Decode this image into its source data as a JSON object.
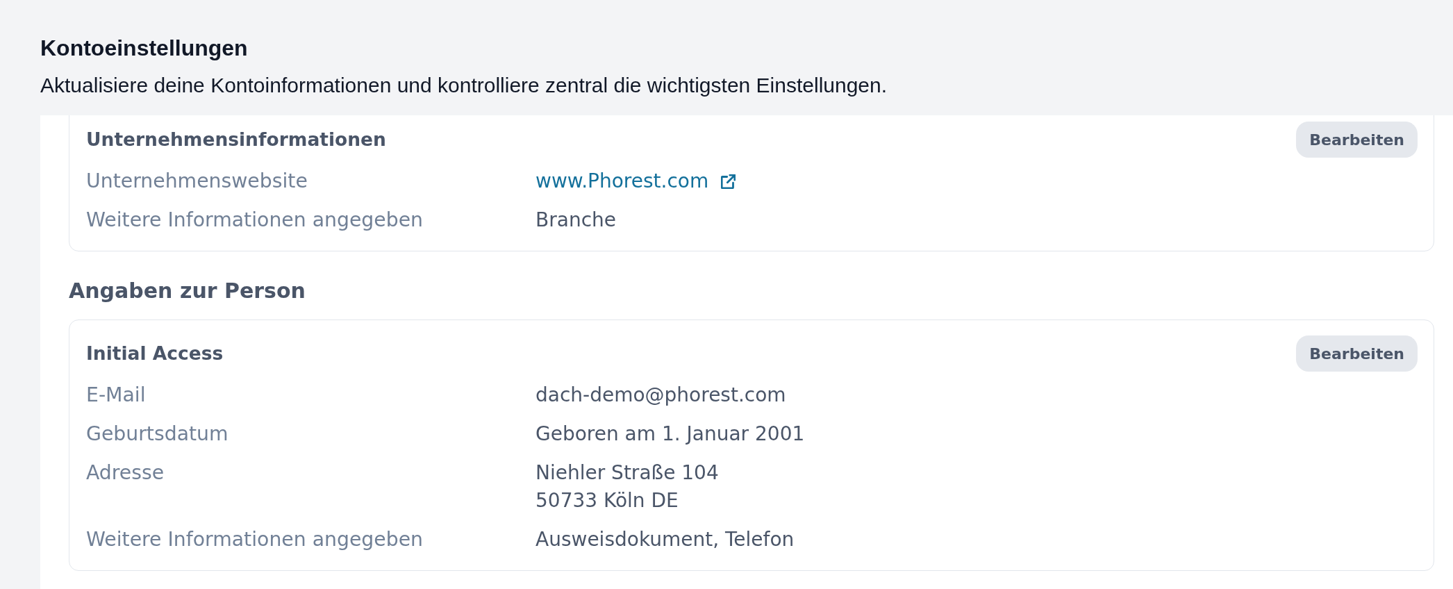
{
  "header": {
    "title": "Kontoeinstellungen",
    "subtitle": "Aktualisiere deine Kontoinformationen und kontrolliere zentral die wichtigsten Einstellungen."
  },
  "sections": [
    {
      "cards": [
        {
          "title": "Unternehmensinformationen",
          "button": "Bearbeiten",
          "rows": [
            {
              "label": "Unternehmenswebsite",
              "kind": "link",
              "lines": [
                "www.Phorest.com"
              ]
            },
            {
              "label": "Weitere Informationen angegeben",
              "kind": "text",
              "lines": [
                "Branche"
              ]
            }
          ]
        }
      ]
    },
    {
      "heading": "Angaben zur Person",
      "cards": [
        {
          "title": "Initial Access",
          "button": "Bearbeiten",
          "rows": [
            {
              "label": "E-Mail",
              "kind": "text",
              "lines": [
                "dach-demo@phorest.com"
              ]
            },
            {
              "label": "Geburtsdatum",
              "kind": "text",
              "lines": [
                "Geboren am 1. Januar 2001"
              ]
            },
            {
              "label": "Adresse",
              "kind": "text",
              "lines": [
                "Niehler Straße 104",
                "50733 Köln DE"
              ]
            },
            {
              "label": "Weitere Informationen angegeben",
              "kind": "text",
              "lines": [
                "Ausweisdokument, Telefon"
              ]
            }
          ]
        }
      ]
    }
  ]
}
